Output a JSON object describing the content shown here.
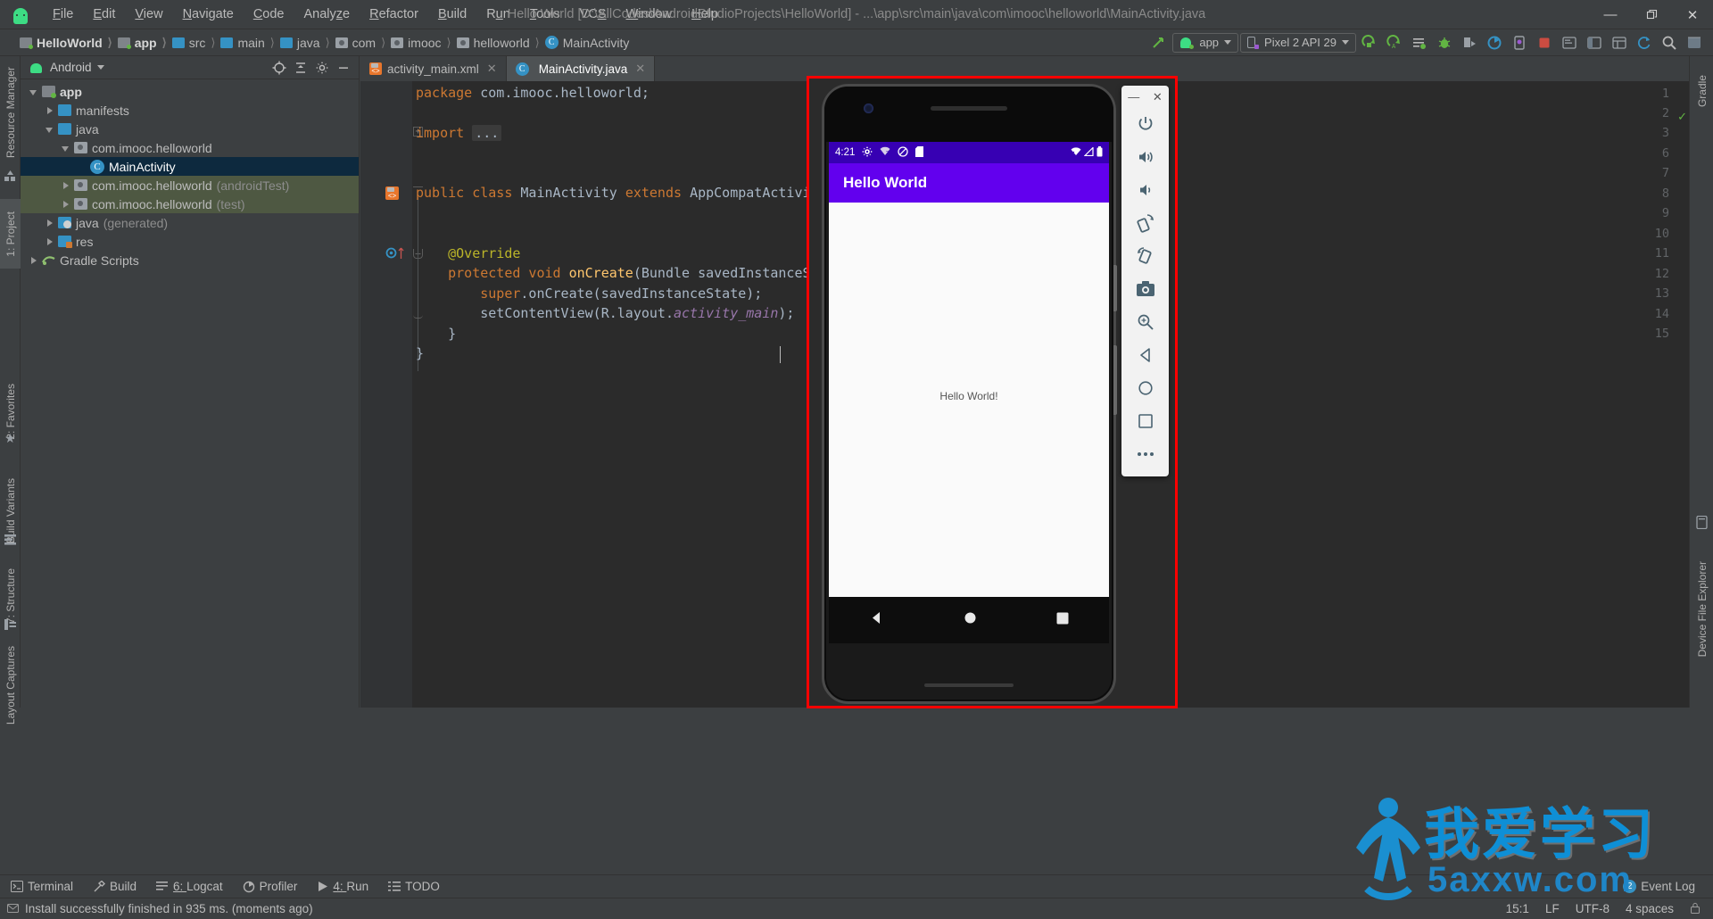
{
  "window": {
    "title": "Hello World [D:\\AllCodes\\AndroidStudioProjects\\HelloWorld] - ...\\app\\src\\main\\java\\com\\imooc\\helloworld\\MainActivity.java",
    "minimize_label": "—",
    "restore_label": "❐",
    "close_label": "✕"
  },
  "menubar": [
    {
      "label": "File"
    },
    {
      "label": "Edit"
    },
    {
      "label": "View"
    },
    {
      "label": "Navigate"
    },
    {
      "label": "Code"
    },
    {
      "label": "Analyze"
    },
    {
      "label": "Refactor"
    },
    {
      "label": "Build"
    },
    {
      "label": "Run"
    },
    {
      "label": "Tools"
    },
    {
      "label": "VCS"
    },
    {
      "label": "Window"
    },
    {
      "label": "Help"
    }
  ],
  "breadcrumbs": [
    {
      "label": "HelloWorld",
      "icon": "module-folder-icon",
      "bold": true
    },
    {
      "label": "app",
      "icon": "module-folder-icon",
      "bold": true
    },
    {
      "label": "src",
      "icon": "folder-icon",
      "bold": false
    },
    {
      "label": "main",
      "icon": "folder-icon",
      "bold": false
    },
    {
      "label": "java",
      "icon": "folder-icon",
      "bold": false
    },
    {
      "label": "com",
      "icon": "package-icon",
      "bold": false
    },
    {
      "label": "imooc",
      "icon": "package-icon",
      "bold": false
    },
    {
      "label": "helloworld",
      "icon": "package-icon",
      "bold": false
    },
    {
      "label": "MainActivity",
      "icon": "class-icon",
      "bold": false
    }
  ],
  "toolbar": {
    "run_config": "app",
    "device": "Pixel 2 API 29",
    "buttons": [
      "sync-project-icon",
      "run-icon",
      "run-anything-icon",
      "apply-changes-icon",
      "debug-icon",
      "profiler-icon",
      "attach-debugger-icon",
      "stop-icon",
      "avd-manager-icon",
      "sdk-manager-icon",
      "project-structure-icon",
      "layout-inspector-icon",
      "search-icon",
      "help-icon"
    ]
  },
  "left_rail": [
    {
      "label": "Resource Manager"
    },
    {
      "label": "1: Project",
      "selected": true
    },
    {
      "label": "2: Favorites"
    },
    {
      "label": "Build Variants"
    },
    {
      "label": "7: Structure"
    },
    {
      "label": "Layout Captures"
    }
  ],
  "right_rail": [
    {
      "label": "Gradle"
    },
    {
      "label": "Device File Explorer"
    }
  ],
  "project_panel": {
    "title": "Android",
    "actions": [
      "target-icon",
      "collapse-all-icon",
      "settings-icon",
      "hide-icon"
    ],
    "tree": [
      {
        "label": "app",
        "depth": 0,
        "arrow": "open",
        "icon": "module-folder-icon",
        "bold": true,
        "state": "normal"
      },
      {
        "label": "manifests",
        "depth": 1,
        "arrow": "closed",
        "icon": "folder-icon",
        "bold": false,
        "state": "normal"
      },
      {
        "label": "java",
        "depth": 1,
        "arrow": "open",
        "icon": "folder-icon",
        "bold": false,
        "state": "normal"
      },
      {
        "label": "com.imooc.helloworld",
        "depth": 2,
        "arrow": "open",
        "icon": "package-icon",
        "bold": false,
        "state": "normal"
      },
      {
        "label": "MainActivity",
        "depth": 3,
        "arrow": "none",
        "icon": "class-icon",
        "bold": false,
        "state": "selected"
      },
      {
        "label": "com.imooc.helloworld",
        "suffix": "(androidTest)",
        "depth": 2,
        "arrow": "closed",
        "icon": "package-icon",
        "bold": false,
        "state": "scope"
      },
      {
        "label": "com.imooc.helloworld",
        "suffix": "(test)",
        "depth": 2,
        "arrow": "closed",
        "icon": "package-icon",
        "bold": false,
        "state": "scope"
      },
      {
        "label": "java",
        "suffix": "(generated)",
        "depth": 1,
        "arrow": "closed",
        "icon": "generated-folder-icon",
        "bold": false,
        "state": "normal"
      },
      {
        "label": "res",
        "depth": 1,
        "arrow": "closed",
        "icon": "res-folder-icon",
        "bold": false,
        "state": "normal"
      },
      {
        "label": "Gradle Scripts",
        "depth": 0,
        "arrow": "closed",
        "icon": "gradle-icon",
        "bold": false,
        "state": "normal"
      }
    ]
  },
  "editor": {
    "tabs": [
      {
        "label": "activity_main.xml",
        "icon": "xml-layout-icon",
        "active": false
      },
      {
        "label": "MainActivity.java",
        "icon": "class-icon",
        "active": true
      }
    ],
    "line_numbers": [
      "1",
      "2",
      "3",
      "6",
      "7",
      "8",
      "9",
      "10",
      "11",
      "12",
      "13",
      "14",
      "15"
    ],
    "code_lines": [
      {
        "num": "1",
        "tokens": [
          {
            "t": "package ",
            "c": "kw"
          },
          {
            "t": "com.imooc.helloworld;",
            "c": "pl"
          }
        ]
      },
      {
        "num": "2",
        "tokens": []
      },
      {
        "num": "3",
        "tokens": [
          {
            "t": "import ",
            "c": "kw"
          },
          {
            "t": "...",
            "c": "fold"
          }
        ]
      },
      {
        "num": "6",
        "tokens": []
      },
      {
        "num": "7",
        "tokens": [
          {
            "t": "public class ",
            "c": "kw"
          },
          {
            "t": "MainActivity ",
            "c": "pl"
          },
          {
            "t": "extends ",
            "c": "kw"
          },
          {
            "t": "AppCompatActivity {",
            "c": "pl"
          }
        ]
      },
      {
        "num": "8",
        "tokens": []
      },
      {
        "num": "9",
        "tokens": [
          {
            "t": "    @Override",
            "c": "an"
          }
        ]
      },
      {
        "num": "10",
        "tokens": [
          {
            "t": "    protected void ",
            "c": "kw"
          },
          {
            "t": "onCreate",
            "c": "fn"
          },
          {
            "t": "(Bundle savedInstanceState",
            "c": "pl"
          },
          {
            "t": ")",
            "c": "pl"
          },
          {
            "t": " {",
            "c": "pl"
          }
        ]
      },
      {
        "num": "11",
        "tokens": [
          {
            "t": "        ",
            "c": "pl"
          },
          {
            "t": "super",
            "c": "kw"
          },
          {
            "t": ".onCreate(savedInstanceState);",
            "c": "pl"
          }
        ]
      },
      {
        "num": "12",
        "tokens": [
          {
            "t": "        setContentView(R.layout.",
            "c": "pl"
          },
          {
            "t": "activity_main",
            "c": "it"
          },
          {
            "t": ");",
            "c": "pl"
          }
        ]
      },
      {
        "num": "13",
        "tokens": [
          {
            "t": "    }",
            "c": "pl"
          }
        ]
      },
      {
        "num": "14",
        "tokens": [
          {
            "t": "}",
            "c": "pl"
          }
        ]
      },
      {
        "num": "15",
        "tokens": []
      }
    ],
    "inspection_status": "ok-check-icon"
  },
  "emulator": {
    "status_time": "4:21",
    "status_icons": [
      "gear-icon",
      "wifi-off-icon",
      "do-not-disturb-icon",
      "sdcard-icon"
    ],
    "status_right_icons": [
      "wifi-icon",
      "signal-icon",
      "battery-icon"
    ],
    "appbar_title": "Hello World",
    "content_text": "Hello World!",
    "nav_buttons": [
      "back-icon",
      "home-icon",
      "overview-icon"
    ],
    "toolbar": {
      "minimize_label": "—",
      "close_label": "✕",
      "buttons": [
        "power-icon",
        "volume-up-icon",
        "volume-down-icon",
        "rotate-left-icon",
        "rotate-right-icon",
        "screenshot-icon",
        "zoom-icon",
        "back-icon",
        "home-icon",
        "overview-icon",
        "more-icon"
      ]
    }
  },
  "bottom_bar": {
    "items": [
      {
        "label": "Terminal",
        "icon": "terminal-icon",
        "prefix": ""
      },
      {
        "label": "Build",
        "icon": "build-icon",
        "prefix": ""
      },
      {
        "label": "Logcat",
        "icon": "logcat-icon",
        "prefix": "6: "
      },
      {
        "label": "Profiler",
        "icon": "profiler-icon",
        "prefix": ""
      },
      {
        "label": "Run",
        "icon": "run-icon",
        "prefix": "4: "
      },
      {
        "label": "TODO",
        "icon": "todo-icon",
        "prefix": ""
      }
    ],
    "event_log_label": "Event Log",
    "event_log_count": "2"
  },
  "statusbar": {
    "message": "Install successfully finished in 935 ms. (moments ago)",
    "caret": "15:1",
    "line_sep": "LF",
    "encoding": "UTF-8",
    "indent": "4 spaces"
  },
  "watermark": {
    "main": "我爱学习",
    "sub": "5axxw.com"
  },
  "colors": {
    "accent_blue": "#3592c4",
    "android_green": "#3ddc84",
    "selection": "#0d293e",
    "scope_green": "#4e5842",
    "emu_highlight": "#ff0000",
    "app_bar_purple": "#6200ee",
    "status_purple": "#3700b3",
    "keyword_orange": "#cc7832",
    "plain_text": "#a9b7c6"
  }
}
